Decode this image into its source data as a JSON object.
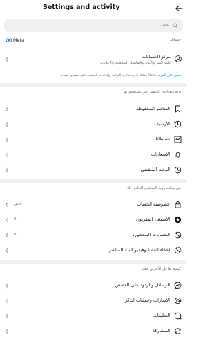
{
  "header": {
    "title": "Settings and activity"
  },
  "search": {
    "placeholder": "بحث"
  },
  "meta_section": {
    "label": "حسابك",
    "logo_text": "Meta"
  },
  "accounts_center": {
    "title": "مركز الحسابات",
    "subtitle": "كلمة السر والأمان والتفاصيل الشخصية والإعلانات",
    "description_text": "يمكنك إدارة تجارب الترابط وإعدادات الحساب على مستوى تقنيات",
    "description_meta": "Meta.",
    "description_link": "تعرف على المزيد"
  },
  "section_usage": {
    "label": "الكيفية التي تستخدم بها Instagram",
    "items": [
      {
        "label": "العناصر المحفوظة",
        "icon": "bookmark-icon"
      },
      {
        "label": "الأرشيف",
        "icon": "archive-icon"
      },
      {
        "label": "نشاطاتك",
        "icon": "activity-icon"
      },
      {
        "label": "الإشعارات",
        "icon": "bell-icon"
      },
      {
        "label": "الوقت المنقضي",
        "icon": "clock-icon"
      }
    ]
  },
  "section_visibility": {
    "label": "من يمكنه رؤية المحتوى الخاص بك",
    "items": [
      {
        "label": "خصوصية الحساب",
        "value": "خاص",
        "icon": "lock-icon"
      },
      {
        "label": "الأصدقاء المقربون",
        "value": "0",
        "icon": "close-friends-star-icon"
      },
      {
        "label": "الحسابات المحظورة",
        "value": "0",
        "icon": "block-icon"
      },
      {
        "label": "إخفاء القصة وفيديو البث المباشر",
        "value": "",
        "icon": "hide-story-icon"
      }
    ]
  },
  "section_interaction": {
    "label": "كيفية تفاعل الآخرين معك",
    "items": [
      {
        "label": "الرسائل والردود على القصص",
        "icon": "messenger-icon"
      },
      {
        "label": "الإشارات وعمليات الذكر",
        "icon": "at-icon"
      },
      {
        "label": "التعليقات",
        "icon": "comment-icon"
      },
      {
        "label": "المشاركة",
        "icon": "share-icon"
      }
    ]
  },
  "colors": {
    "link": "#0095f6",
    "muted": "#737373",
    "divider": "#efefef"
  }
}
